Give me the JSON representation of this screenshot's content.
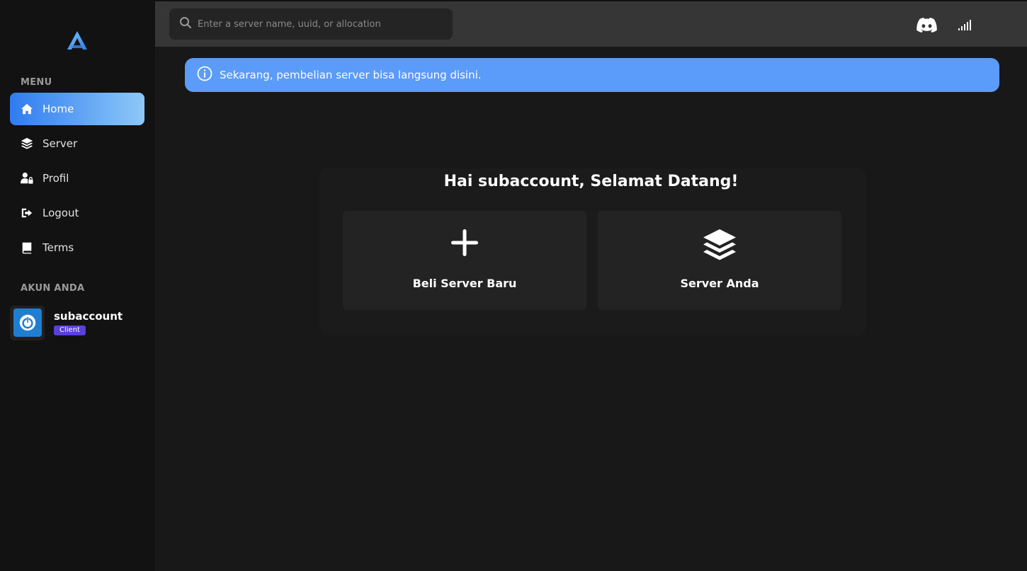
{
  "sidebar": {
    "logo_icon": "triangle-logo-icon",
    "menu_label": "MENU",
    "items": [
      {
        "label": "Home",
        "icon": "home-icon",
        "active": true
      },
      {
        "label": "Server",
        "icon": "layers-icon"
      },
      {
        "label": "Profil",
        "icon": "user-lock-icon"
      },
      {
        "label": "Logout",
        "icon": "logout-icon"
      },
      {
        "label": "Terms",
        "icon": "book-icon"
      }
    ],
    "account_label": "AKUN ANDA",
    "account": {
      "name": "subaccount",
      "role": "Client",
      "avatar_icon": "power-icon"
    }
  },
  "topbar": {
    "search_placeholder": "Enter a server name, uuid, or allocation",
    "icons": [
      "discord-icon",
      "signal-icon"
    ]
  },
  "alert": {
    "text": "Sekarang, pembelian server bisa langsung disini.",
    "icon": "info-icon"
  },
  "welcome": {
    "title": "Hai subaccount, Selamat Datang!",
    "tiles": [
      {
        "label": "Beli Server Baru",
        "icon": "plus-icon"
      },
      {
        "label": "Server Anda",
        "icon": "layers-icon"
      }
    ]
  },
  "colors": {
    "accent": "#2f7cf0",
    "alert_bg": "#5b9cfa",
    "badge_bg": "#5b3fdc",
    "sidebar_bg": "#121212",
    "topbar_bg": "#363636"
  }
}
